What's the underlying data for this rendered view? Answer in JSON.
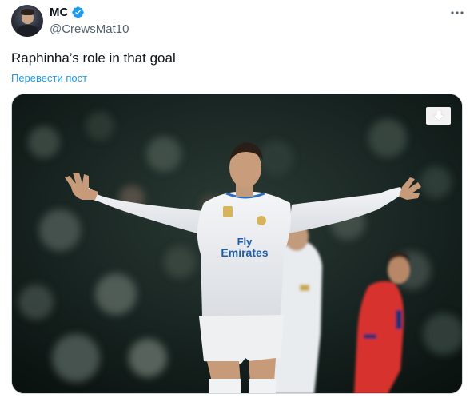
{
  "author": {
    "display_name": "MC",
    "handle": "@CrewsMat10",
    "verified": true
  },
  "tweet": {
    "text": "Raphinha’s role in that goal",
    "translate_label": "Перевести пост"
  },
  "icons": {
    "verified": "verified-badge-icon",
    "more": "more-options-icon",
    "download": "download-icon"
  },
  "colors": {
    "accent": "#1d9bf0",
    "secondary_text": "#536471",
    "primary_text": "#0f1419"
  }
}
